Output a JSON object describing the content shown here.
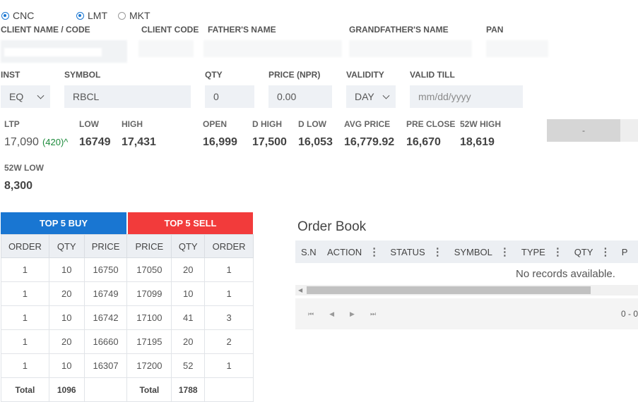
{
  "order_type": {
    "cnc": "CNC",
    "lmt": "LMT",
    "mkt": "MKT",
    "selected": [
      "CNC",
      "LMT"
    ]
  },
  "client": {
    "labels": {
      "client_name_code": "CLIENT NAME / CODE",
      "client_code": "CLIENT CODE",
      "fathers_name": "FATHER'S NAME",
      "grandfathers_name": "GRANDFATHER'S NAME",
      "pan": "PAN"
    }
  },
  "form": {
    "labels": {
      "inst": "INST",
      "symbol": "SYMBOL",
      "qty": "QTY",
      "price": "PRICE (NPR)",
      "validity": "VALIDITY",
      "valid_till": "VALID TILL"
    },
    "inst_value": "EQ",
    "symbol_value": "RBCL",
    "qty_value": "0",
    "price_value": "0.00",
    "validity_value": "DAY",
    "valid_till_placeholder": "mm/dd/yyyy"
  },
  "stats": {
    "ltp_label": "LTP",
    "ltp_value": "17,090",
    "ltp_change": "(420)^",
    "low_label": "LOW",
    "low_value": "16749",
    "high_label": "HIGH",
    "high_value": "17,431",
    "open_label": "OPEN",
    "open_value": "16,999",
    "dhigh_label": "D HIGH",
    "dhigh_value": "17,500",
    "dlow_label": "D LOW",
    "dlow_value": "16,053",
    "avg_label": "AVG PRICE",
    "avg_value": "16,779.92",
    "preclose_label": "PRE CLOSE",
    "preclose_value": "16,670",
    "w52high_label": "52W HIGH",
    "w52high_value": "18,619",
    "w52low_label": "52W LOW",
    "w52low_value": "8,300",
    "action_button": "-"
  },
  "depth": {
    "buy_title": "TOP 5 BUY",
    "sell_title": "TOP 5 SELL",
    "headers": [
      "ORDER",
      "QTY",
      "PRICE",
      "PRICE",
      "QTY",
      "ORDER"
    ],
    "rows": [
      [
        "1",
        "10",
        "16750",
        "17050",
        "20",
        "1"
      ],
      [
        "1",
        "20",
        "16749",
        "17099",
        "10",
        "1"
      ],
      [
        "1",
        "10",
        "16742",
        "17100",
        "41",
        "3"
      ],
      [
        "1",
        "20",
        "16660",
        "17195",
        "20",
        "2"
      ],
      [
        "1",
        "10",
        "16307",
        "17200",
        "52",
        "1"
      ]
    ],
    "total": [
      "Total",
      "1096",
      "",
      "Total",
      "1788",
      ""
    ]
  },
  "order_book": {
    "title": "Order Book",
    "columns": [
      "S.N",
      "ACTION",
      "STATUS",
      "SYMBOL",
      "TYPE",
      "QTY",
      "P"
    ],
    "empty_message": "No records available.",
    "pager_text": "0 - 0"
  }
}
